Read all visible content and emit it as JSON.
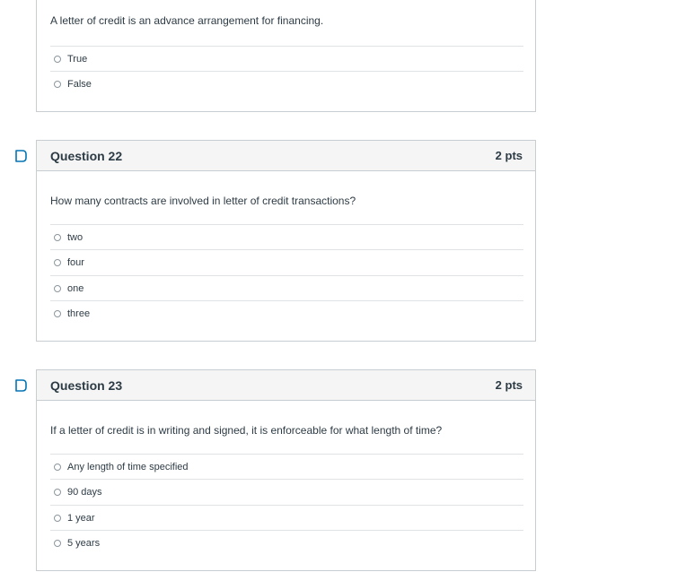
{
  "prev_question": {
    "text": "A letter of credit is an advance arrangement for financing.",
    "answers": [
      "True",
      "False"
    ]
  },
  "questions": [
    {
      "title": "Question 22",
      "points": "2 pts",
      "text": "How many contracts are involved in letter of credit transactions?",
      "answers": [
        "two",
        "four",
        "one",
        "three"
      ]
    },
    {
      "title": "Question 23",
      "points": "2 pts",
      "text": "If a letter of credit is in writing and signed, it is enforceable for what length of time?",
      "answers": [
        "Any length of time specified",
        "90 days",
        "1 year",
        "5 years"
      ]
    }
  ],
  "colors": {
    "flag": "#0374b5",
    "border": "#c7cdd1",
    "header_bg": "#f5f5f5",
    "text": "#2d3b45"
  },
  "icons": {
    "flag": "bookmark-flag-icon",
    "radio": "radio-unselected"
  }
}
